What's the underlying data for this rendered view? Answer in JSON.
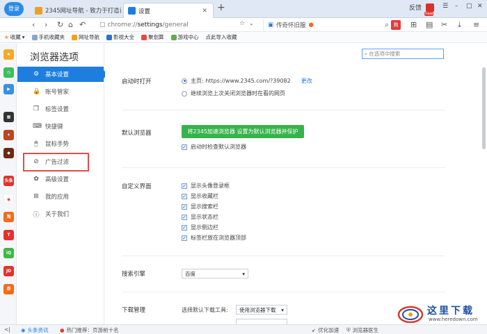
{
  "titlebar": {
    "login_label": "登录",
    "tabs": [
      {
        "title": "2345网址导航 - 致力于打造百",
        "active": false
      },
      {
        "title": "设置",
        "active": true
      }
    ],
    "new_tab": "+",
    "feedback": "反馈",
    "new_badge": "new",
    "window_controls": [
      "–",
      "□",
      "✕"
    ]
  },
  "navbar": {
    "url_scheme": "chrome://",
    "url_path": "settings",
    "url_rest": "/general",
    "side_text": "传奇怀旧服"
  },
  "bookmarks": {
    "collect_label": "收藏",
    "items": [
      "手机收藏夹",
      "网址导航",
      "影视大全",
      "聚划算",
      "游戏中心",
      "点此导入收藏"
    ]
  },
  "rail": {
    "icons": [
      "收藏",
      "今",
      "视",
      "游",
      "战",
      "游",
      "头条",
      "微",
      "淘",
      "T",
      "iQ",
      "JD",
      "券"
    ]
  },
  "sidebar": {
    "title": "浏览器选项",
    "items": [
      {
        "label": "基本设置",
        "icon": "⚙",
        "active": true
      },
      {
        "label": "账号管家",
        "icon": "🔒",
        "active": false
      },
      {
        "label": "标签设置",
        "icon": "❐",
        "active": false
      },
      {
        "label": "快捷键",
        "icon": "⌨",
        "active": false
      },
      {
        "label": "鼠标手势",
        "icon": "🖱",
        "active": false
      },
      {
        "label": "广告过滤",
        "icon": "⊘",
        "active": false
      },
      {
        "label": "高级设置",
        "icon": "✿",
        "active": false
      },
      {
        "label": "我的应用",
        "icon": "⊞",
        "active": false
      },
      {
        "label": "关于我们",
        "icon": "ⓘ",
        "active": false
      }
    ]
  },
  "content": {
    "search_placeholder": "在选项中搜索",
    "startup": {
      "label": "启动时打开",
      "home_option": "主页: https://www.2345.com/?39082",
      "change_link": "更改",
      "restore_option": "继续浏览上次关闭浏览器时在看的网页"
    },
    "default_browser": {
      "label": "默认浏览器",
      "button": "将2345加速浏览器 设置为默认浏览器并保护",
      "check_on_start": "启动时检查默认浏览器"
    },
    "custom_ui": {
      "label": "自定义界面",
      "options": [
        "显示头像登录框",
        "显示收藏栏",
        "显示搜索栏",
        "显示状态栏",
        "显示侧边栏",
        "标签栏放在浏览器顶部"
      ]
    },
    "search_engine": {
      "label": "搜索引擎",
      "value": "百度"
    },
    "download": {
      "label": "下载管理",
      "tool_label": "选择默认下载工具:",
      "tool_value": "使用浏览器下载"
    }
  },
  "statusbar": {
    "news": "头条资讯",
    "hot": "热门推荐：页游前十名",
    "optimize": "优化加速",
    "doctor": "浏览器医生"
  },
  "watermark": {
    "title": "这里下载",
    "subtitle": "www.heredown.com"
  }
}
